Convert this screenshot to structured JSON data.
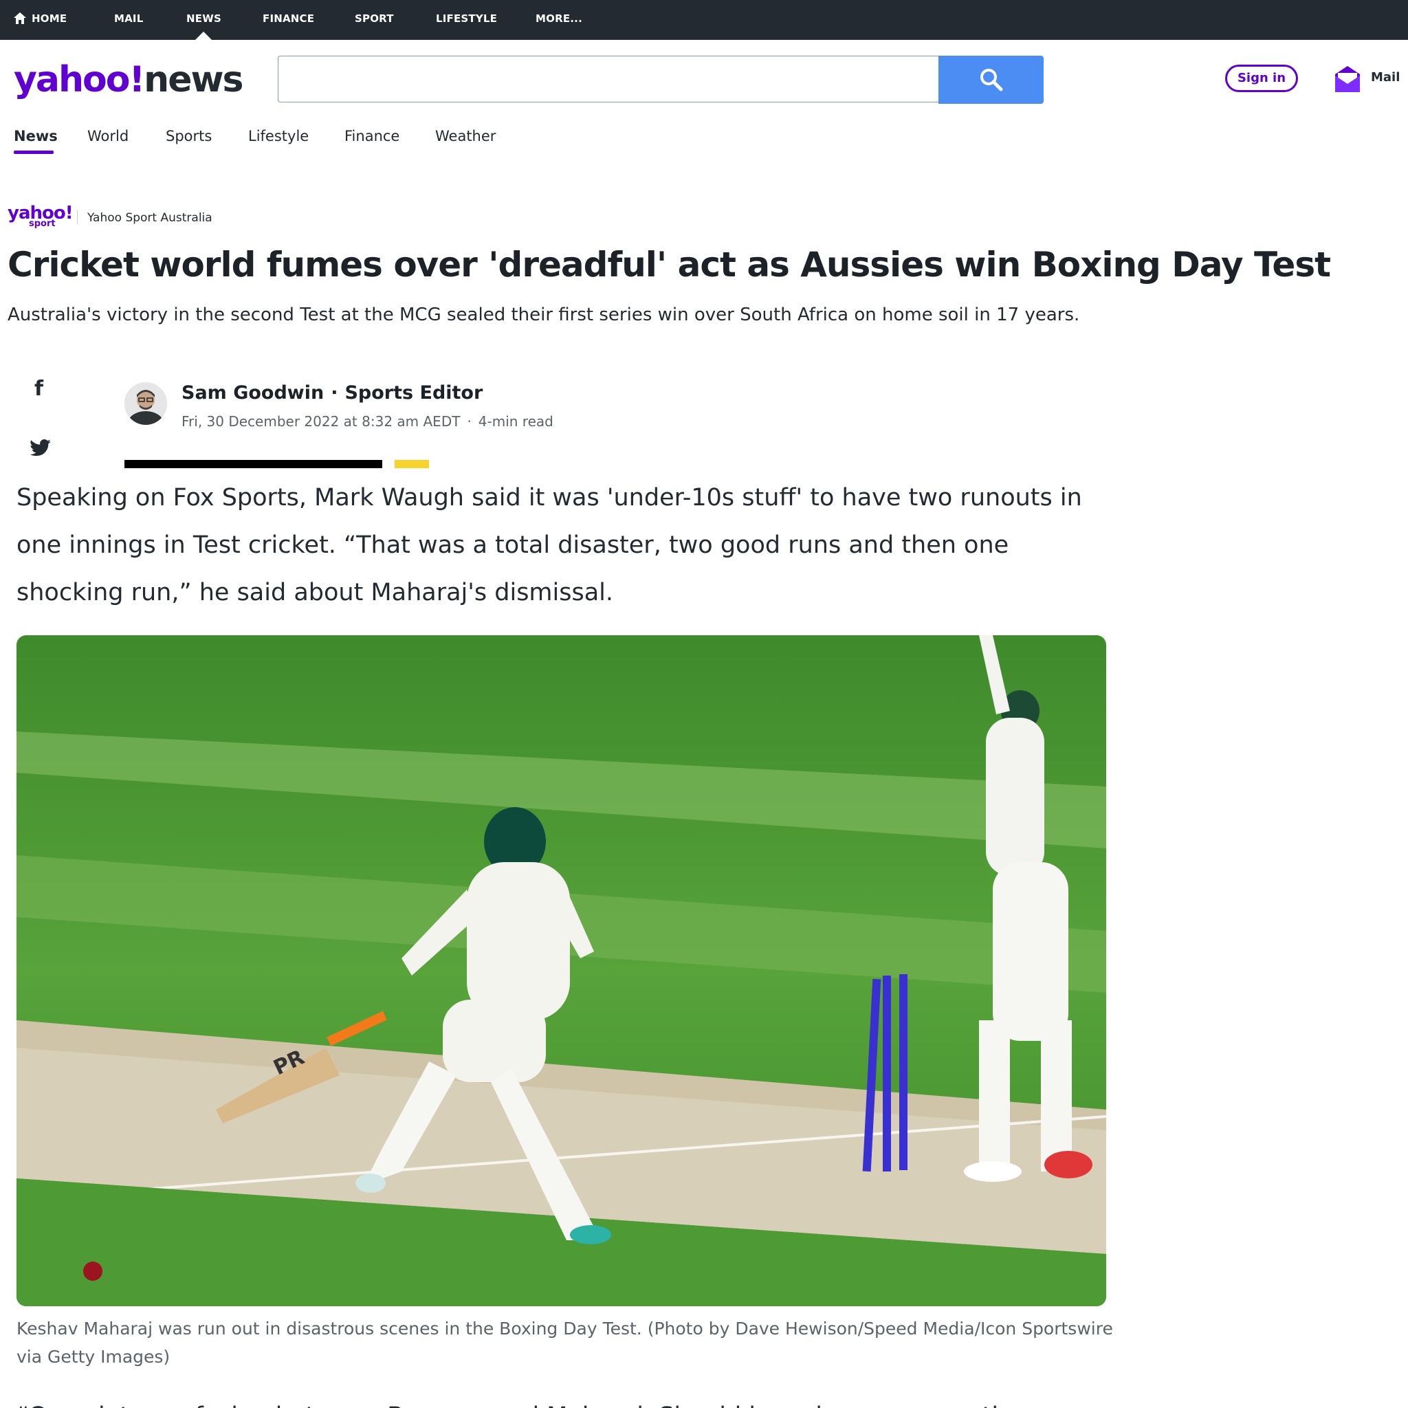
{
  "topbar": {
    "items": [
      "HOME",
      "MAIL",
      "NEWS",
      "FINANCE",
      "SPORT",
      "LIFESTYLE",
      "MORE..."
    ],
    "active": "NEWS"
  },
  "header": {
    "logo_yahoo": "yahoo!",
    "logo_news": "news",
    "search_placeholder": "",
    "sign_in_label": "Sign in",
    "mail_label": "Mail"
  },
  "nav": {
    "items": [
      "News",
      "World",
      "Sports",
      "Lifestyle",
      "Finance",
      "Weather"
    ],
    "active": "News"
  },
  "source": {
    "logo_top": "yahoo!",
    "logo_sub": "sport",
    "name": "Yahoo Sport Australia"
  },
  "article": {
    "headline": "Cricket world fumes over 'dreadful' act as Aussies win Boxing Day Test",
    "subhead": "Australia's victory in the second Test at the MCG sealed their first series win over South Africa on home soil in 17 years.",
    "author_name": "Sam Goodwin",
    "author_role": "Sports Editor",
    "date": "Fri, 30 December 2022 at 8:32 am AEDT",
    "read_time": "4-min read",
    "body": "Speaking on Fox Sports, Mark Waugh said it was 'under-10s stuff' to have two runouts in one innings in Test cricket. “That was a total disaster, two good runs and then one shocking run,” he said about Maharaj's dismissal.",
    "caption": "Keshav Maharaj was run out in disastrous scenes in the Boxing Day Test. (Photo by Dave Hewison/Speed Media/Icon Sportswire via Getty Images)",
    "next_para_fragment": "“Complete confusion between Bavuma and Maharaj. Should have been easy as they"
  },
  "photo": {
    "bat_label": "PR"
  },
  "colors": {
    "topbar_bg": "#232a31",
    "brand_purple": "#6001d2",
    "search_blue": "#4b8df2",
    "progress_yellow": "#f8d22f"
  },
  "icons": [
    "home-icon",
    "search-icon",
    "mail-icon",
    "facebook-icon",
    "twitter-icon"
  ]
}
